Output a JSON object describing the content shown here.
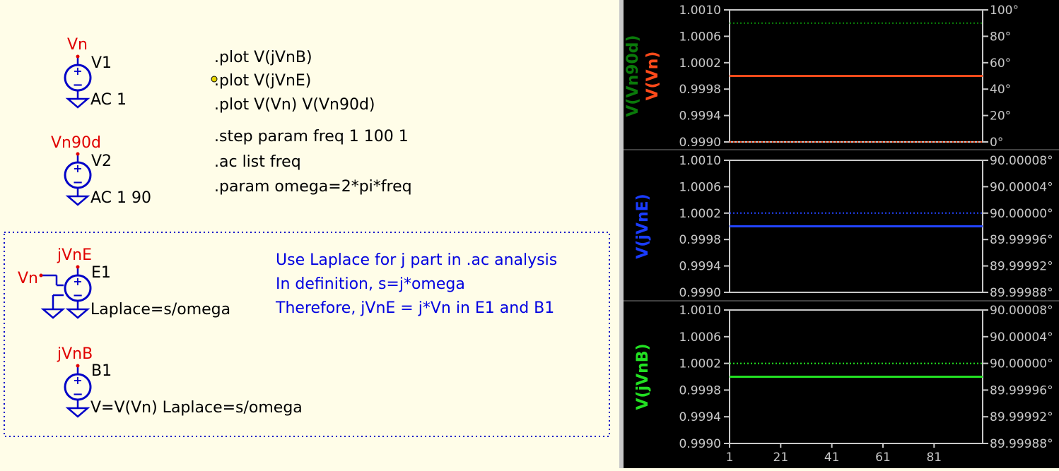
{
  "schematic": {
    "sources": [
      {
        "id": "v1",
        "net": "Vn",
        "ref": "V1",
        "value": "AC 1"
      },
      {
        "id": "v2",
        "net": "Vn90d",
        "ref": "V2",
        "value": "AC 1 90"
      },
      {
        "id": "e1",
        "net": "jVnE",
        "ref": "E1",
        "value": "Laplace=s/omega",
        "input_net": "Vn"
      },
      {
        "id": "b1",
        "net": "jVnB",
        "ref": "B1",
        "value": "V=V(Vn) Laplace=s/omega"
      }
    ],
    "directives": [
      ".plot V(jVnB)",
      ".plot V(jVnE)",
      ".plot V(Vn) V(Vn90d)",
      ".step param freq 1 100 1",
      ".ac list freq",
      ".param omega=2*pi*freq"
    ],
    "comment": [
      "Use Laplace for j part in .ac analysis",
      "In definition, s=j*omega",
      "Therefore, jVnE = j*Vn in E1 and B1"
    ],
    "colors": {
      "net_label": "#e00000",
      "component": "#0000c8",
      "comment": "#0000e0",
      "wire": "#0000c8"
    }
  },
  "waveform": {
    "panes": [
      {
        "traces": [
          {
            "name": "V(Vn90d)",
            "color": "#0a7a0a"
          },
          {
            "name": "V(Vn)",
            "color": "#ff4a1a"
          }
        ],
        "left_ticks": [
          "1.0010",
          "1.0006",
          "1.0002",
          "0.9998",
          "0.9994",
          "0.9990"
        ],
        "right_ticks": [
          "100°",
          "80°",
          "60°",
          "40°",
          "20°",
          "0°"
        ],
        "lines": [
          {
            "trace": "V(Vn90d)",
            "kind": "magnitude",
            "value": 1.0,
            "color": "#0a8a0a"
          },
          {
            "trace": "V(Vn90d)",
            "kind": "phase",
            "value": 90,
            "color": "#0a8a0a"
          },
          {
            "trace": "V(Vn)",
            "kind": "magnitude",
            "value": 1.0,
            "color": "#ff4a1a"
          },
          {
            "trace": "V(Vn)",
            "kind": "phase",
            "value": 0,
            "color": "#ff4a1a"
          }
        ]
      },
      {
        "traces": [
          {
            "name": "V(jVnE)",
            "color": "#1a3cff"
          }
        ],
        "left_ticks": [
          "1.0010",
          "1.0006",
          "1.0002",
          "0.9998",
          "0.9994",
          "0.9990"
        ],
        "right_ticks": [
          "90.00008°",
          "90.00004°",
          "90.00000°",
          "89.99996°",
          "89.99992°",
          "89.99988°"
        ],
        "lines": [
          {
            "trace": "V(jVnE)",
            "kind": "magnitude",
            "value": 1.0,
            "color": "#2244ff"
          },
          {
            "trace": "V(jVnE)",
            "kind": "phase",
            "value": 90.0,
            "color": "#2244ff"
          }
        ]
      },
      {
        "traces": [
          {
            "name": "V(jVnB)",
            "color": "#22e022"
          }
        ],
        "left_ticks": [
          "1.0010",
          "1.0006",
          "1.0002",
          "0.9998",
          "0.9994",
          "0.9990"
        ],
        "right_ticks": [
          "90.00008°",
          "90.00004°",
          "90.00000°",
          "89.99996°",
          "89.99992°",
          "89.99988°"
        ],
        "lines": [
          {
            "trace": "V(jVnB)",
            "kind": "magnitude",
            "value": 1.0,
            "color": "#22e022"
          },
          {
            "trace": "V(jVnB)",
            "kind": "phase",
            "value": 90.0,
            "color": "#22e022"
          }
        ]
      }
    ],
    "x_ticks": [
      "1",
      "21",
      "41",
      "61",
      "81"
    ],
    "x_range": [
      1,
      100
    ],
    "axis_color": "#c8c8c8",
    "label_color": "#c8c8c8"
  }
}
